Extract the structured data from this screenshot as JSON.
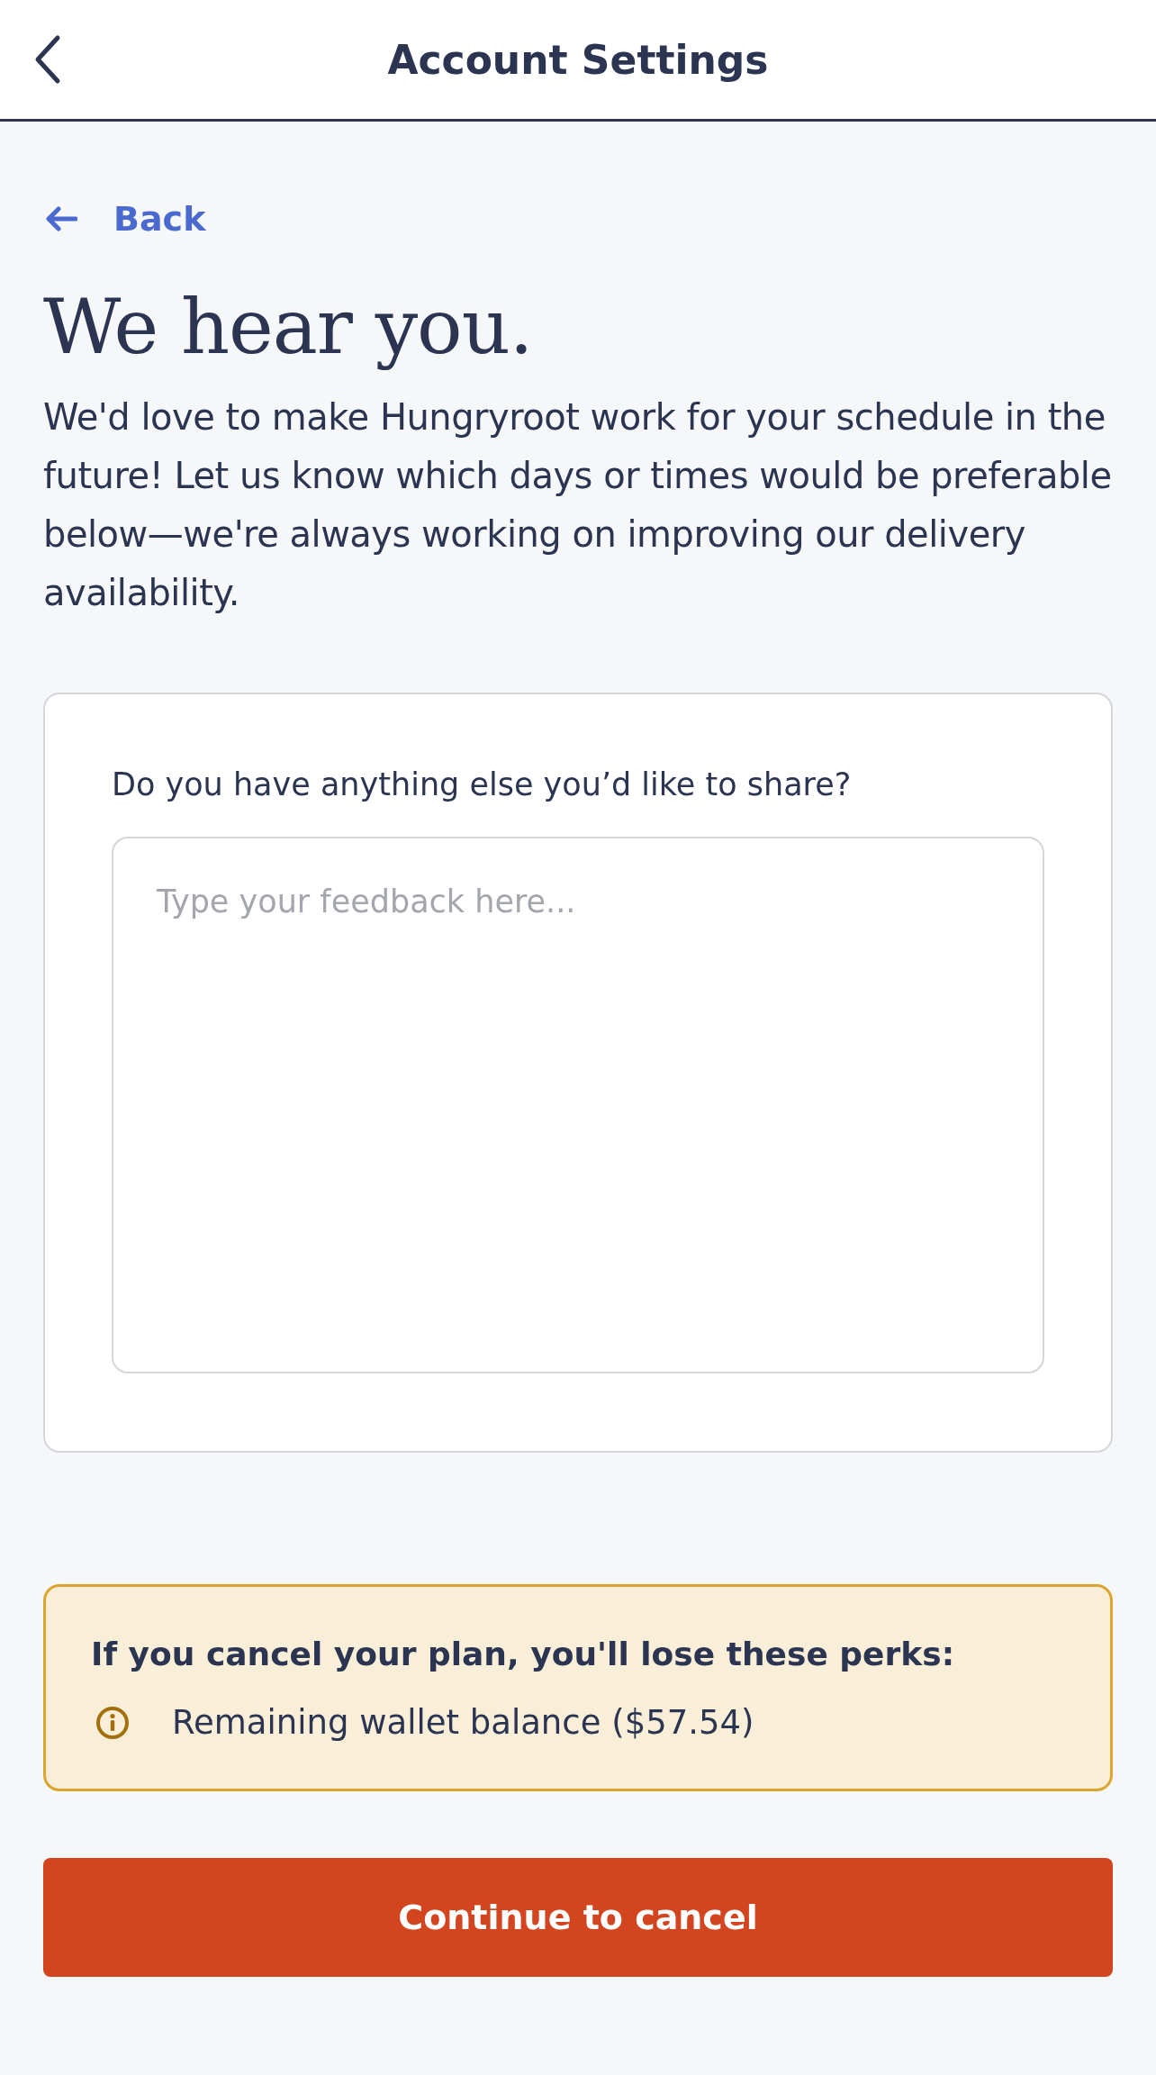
{
  "header": {
    "title": "Account Settings"
  },
  "back_link": {
    "label": "Back"
  },
  "heading": "We hear you.",
  "intro": "We'd love to make Hungryroot work for your schedule in the future! Let us know which days or times would be preferable below—we're always working on improving our delivery availability.",
  "feedback_card": {
    "question": "Do you have anything else you’d like to share?",
    "placeholder": "Type your feedback here..."
  },
  "perks_notice": {
    "title": "If you cancel your plan, you'll lose these perks:",
    "items": [
      "Remaining wallet balance ($57.54)"
    ]
  },
  "buttons": [
    "Continue to cancel"
  ]
}
